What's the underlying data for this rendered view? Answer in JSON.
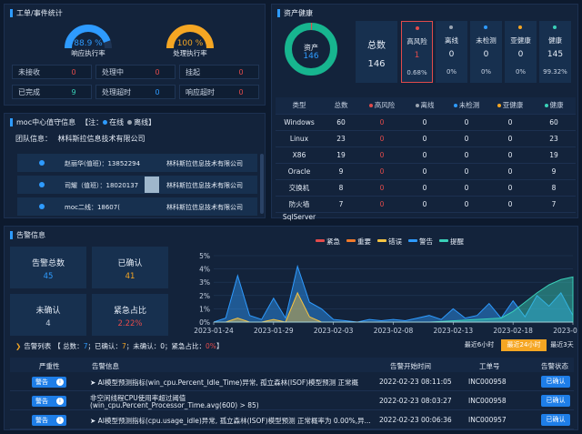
{
  "workorder": {
    "title": "工单/事件统计",
    "gauge1": {
      "value": "88.9 %",
      "label": "响应执行率",
      "fraction": 0.889
    },
    "gauge2": {
      "value": "100 %",
      "label": "处理执行率",
      "fraction": 1.0
    },
    "stats": [
      {
        "label": "未接收",
        "value": "0",
        "color": "#e24b4b"
      },
      {
        "label": "处理中",
        "value": "0",
        "color": "#e24b4b"
      },
      {
        "label": "挂起",
        "value": "0",
        "color": "#e24b4b"
      },
      {
        "label": "已完成",
        "value": "9",
        "color": "#3ad0b8"
      },
      {
        "label": "处理超时",
        "value": "0",
        "color": "#2e9bff"
      },
      {
        "label": "响应超时",
        "value": "0",
        "color": "#e24b4b"
      }
    ]
  },
  "duty": {
    "title": "moc中心值守信息",
    "legend_prefix": "【注：",
    "legend_online": "在线",
    "legend_offline": "离线",
    "legend_suffix": "】",
    "team_label": "团队信息：",
    "team_name": "林科斯拉信息技术有限公司",
    "rows": [
      {
        "name": "赵丽华(值班)：13852294",
        "company": "林科斯拉信息技术有限公司"
      },
      {
        "name": "司耀（值班）：18020137",
        "company": "林科斯拉信息技术有限公司"
      },
      {
        "name": "moc二线：18607(",
        "company": "林科斯拉信息技术有限公司"
      }
    ]
  },
  "assets": {
    "title": "资产健康",
    "donut_label": "资产",
    "donut_value": "146",
    "total_label": "总数",
    "total_value": "146",
    "cards": [
      {
        "label": "高风险",
        "value": "1",
        "pct": "0.68%",
        "dot": "#e24b4b",
        "highlight": true
      },
      {
        "label": "离线",
        "value": "0",
        "pct": "0%",
        "dot": "#9aa4b1",
        "highlight": false
      },
      {
        "label": "未检测",
        "value": "0",
        "pct": "0%",
        "dot": "#2e9bff",
        "highlight": false
      },
      {
        "label": "亚健康",
        "value": "0",
        "pct": "0%",
        "dot": "#f5a623",
        "highlight": false
      },
      {
        "label": "健康",
        "value": "145",
        "pct": "99.32%",
        "dot": "#3ad0b8",
        "highlight": false
      }
    ],
    "table_headers": [
      "类型",
      "总数",
      "高风险",
      "离线",
      "未检测",
      "亚健康",
      "健康"
    ],
    "header_dots": [
      "",
      "",
      "#e24b4b",
      "#9aa4b1",
      "#2e9bff",
      "#f5a623",
      "#3ad0b8"
    ],
    "rows": [
      [
        "Windows",
        "60",
        "0",
        "0",
        "0",
        "0",
        "60"
      ],
      [
        "Linux",
        "23",
        "0",
        "0",
        "0",
        "0",
        "23"
      ],
      [
        "X86",
        "19",
        "0",
        "0",
        "0",
        "0",
        "19"
      ],
      [
        "Oracle",
        "9",
        "0",
        "0",
        "0",
        "0",
        "9"
      ],
      [
        "交换机",
        "8",
        "0",
        "0",
        "0",
        "0",
        "8"
      ],
      [
        "防火墙",
        "7",
        "0",
        "0",
        "0",
        "0",
        "7"
      ],
      [
        "SqlServer",
        "",
        "",
        "",
        "",
        "",
        ""
      ]
    ]
  },
  "alerts": {
    "title": "告警信息",
    "kpis": [
      {
        "label": "告警总数",
        "value": "45",
        "color": "#2e9bff"
      },
      {
        "label": "已确认",
        "value": "41",
        "color": "#f5a623"
      },
      {
        "label": "未确认",
        "value": "4",
        "color": "#c9d4e4"
      },
      {
        "label": "紧急占比",
        "value": "2.22%",
        "color": "#e24b4b"
      }
    ],
    "list_title": "告警列表",
    "summary_open": "【 总数：",
    "summary_total": "7",
    "summary_sep1": "；已确认：",
    "summary_confirmed": "7",
    "summary_sep2": "；未确认：",
    "summary_unconfirmed": "0",
    "summary_sep3": "；紧急占比：",
    "summary_ratio": "0%",
    "summary_close": "】",
    "time_tabs": [
      {
        "label": "最近6小时",
        "active": false
      },
      {
        "label": "最近24小时",
        "active": true
      },
      {
        "label": "最近3天",
        "active": false
      }
    ],
    "columns": [
      "严重性",
      "告警信息",
      "告警开始时间",
      "工单号",
      "告警状态"
    ],
    "rows": [
      {
        "severity": "警告",
        "info": "➤ AI模型预测指标(win_cpu.Percent_Idle_Time)异常, 孤立森林(ISOF)模型预测 正常概",
        "info2": "",
        "time": "2022-02-23 08:11:05",
        "ticket": "INC000958",
        "status": "已确认"
      },
      {
        "severity": "警告",
        "info": "非空闲线程CPU使用率超过阈值",
        "info2": "(win_cpu.Percent_Processor_Time.avg(600) > 85)",
        "time": "2022-02-23 08:03:27",
        "ticket": "INC000958",
        "status": "已确认"
      },
      {
        "severity": "警告",
        "info": "➤ AI模型预测指标(cpu.usage_idle)异常, 孤立森林(ISOF)模型预测 正常概率为 0.00%,异...",
        "info2": "",
        "time": "2022-02-23 00:06:36",
        "ticket": "INC000957",
        "status": "已确认"
      }
    ]
  },
  "chart_data": {
    "type": "area",
    "legend": [
      {
        "name": "紧急",
        "color": "#e24b4b"
      },
      {
        "name": "重要",
        "color": "#f07a2a"
      },
      {
        "name": "错误",
        "color": "#f5c342"
      },
      {
        "name": "警告",
        "color": "#2e9bff"
      },
      {
        "name": "提醒",
        "color": "#3ad0b8"
      }
    ],
    "y_ticks": [
      "0%",
      "1%",
      "2%",
      "3%",
      "4%",
      "5%"
    ],
    "ylim": [
      0,
      5
    ],
    "x_ticks": [
      "2023-01-24",
      "2023-01-29",
      "2023-02-03",
      "2023-02-08",
      "2023-02-13",
      "2023-02-18",
      "2023-02-23"
    ],
    "xlim": [
      0,
      30
    ],
    "series": [
      {
        "name": "警告",
        "color": "#2e9bff",
        "points": [
          [
            0,
            0
          ],
          [
            1,
            0.3
          ],
          [
            2,
            3.5
          ],
          [
            3,
            0.5
          ],
          [
            4,
            0.2
          ],
          [
            5,
            1.8
          ],
          [
            6,
            0.3
          ],
          [
            7,
            4.2
          ],
          [
            8,
            1.5
          ],
          [
            9,
            1.0
          ],
          [
            10,
            0.2
          ],
          [
            11,
            0.1
          ],
          [
            12,
            0
          ],
          [
            13,
            0.2
          ],
          [
            14,
            0.1
          ],
          [
            15,
            0.2
          ],
          [
            16,
            0.1
          ],
          [
            17,
            0.3
          ],
          [
            18,
            0.5
          ],
          [
            19,
            0.2
          ],
          [
            20,
            1.0
          ],
          [
            21,
            0.3
          ],
          [
            22,
            0.5
          ],
          [
            23,
            1.4
          ],
          [
            24,
            0.3
          ],
          [
            25,
            1.6
          ],
          [
            26,
            0.4
          ],
          [
            27,
            2.0
          ],
          [
            28,
            1.2
          ],
          [
            29,
            2.2
          ],
          [
            30,
            0.5
          ]
        ]
      },
      {
        "name": "错误",
        "color": "#f5c342",
        "points": [
          [
            0,
            0
          ],
          [
            1,
            0
          ],
          [
            2,
            0.3
          ],
          [
            3,
            0
          ],
          [
            4,
            0
          ],
          [
            5,
            0.2
          ],
          [
            6,
            0
          ],
          [
            7,
            2.2
          ],
          [
            8,
            0.4
          ],
          [
            9,
            0
          ],
          [
            10,
            0
          ],
          [
            15,
            0
          ],
          [
            20,
            0
          ],
          [
            25,
            0
          ],
          [
            30,
            0
          ]
        ]
      },
      {
        "name": "提醒",
        "color": "#3ad0b8",
        "points": [
          [
            0,
            0
          ],
          [
            6,
            0
          ],
          [
            12,
            0
          ],
          [
            18,
            0
          ],
          [
            24,
            0.3
          ],
          [
            25,
            0.8
          ],
          [
            26,
            1.5
          ],
          [
            27,
            2.2
          ],
          [
            28,
            2.8
          ],
          [
            29,
            3.2
          ],
          [
            30,
            3.4
          ]
        ]
      }
    ]
  }
}
